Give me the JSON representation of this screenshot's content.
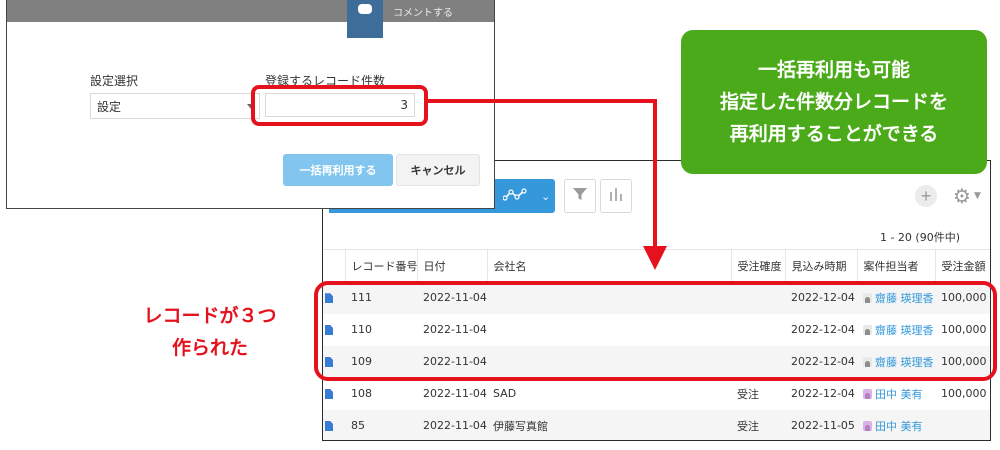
{
  "dialog": {
    "topbar_text": "コメントする",
    "settings_label": "設定選択",
    "settings_value": "設定",
    "count_label": "登録するレコード件数",
    "count_value": "3",
    "reuse_button": "一括再利用する",
    "cancel_button": "キャンセル"
  },
  "list": {
    "pager": "1 - 20 (90件中)",
    "columns": [
      "レコード番号",
      "日付",
      "会社名",
      "受注確度",
      "見込み時期",
      "案件担当者",
      "受注金額"
    ],
    "rows": [
      {
        "id": "111",
        "date": "2022-11-04",
        "company": "",
        "prob": "",
        "expected": "2022-12-04",
        "owner": "齋藤 瑛理香",
        "amount": "100,000"
      },
      {
        "id": "110",
        "date": "2022-11-04",
        "company": "",
        "prob": "",
        "expected": "2022-12-04",
        "owner": "齋藤 瑛理香",
        "amount": "100,000"
      },
      {
        "id": "109",
        "date": "2022-11-04",
        "company": "",
        "prob": "",
        "expected": "2022-12-04",
        "owner": "齋藤 瑛理香",
        "amount": "100,000"
      },
      {
        "id": "108",
        "date": "2022-11-04",
        "company": "SAD",
        "prob": "受注",
        "expected": "2022-12-04",
        "owner": "田中 美有",
        "amount": "100,000"
      },
      {
        "id": "85",
        "date": "2022-11-04",
        "company": "伊藤写真館",
        "prob": "受注",
        "expected": "2022-11-05",
        "owner": "田中 美有",
        "amount": ""
      }
    ]
  },
  "annotations": {
    "callout_line1": "一括再利用も可能",
    "callout_line2": "指定した件数分レコードを",
    "callout_line3": "再利用することができる",
    "note_line1": "レコードが３つ",
    "note_line2": "作られた"
  },
  "colors": {
    "highlight_red": "#e5121e",
    "callout_green": "#4baa19",
    "kintone_blue": "#3498db"
  }
}
